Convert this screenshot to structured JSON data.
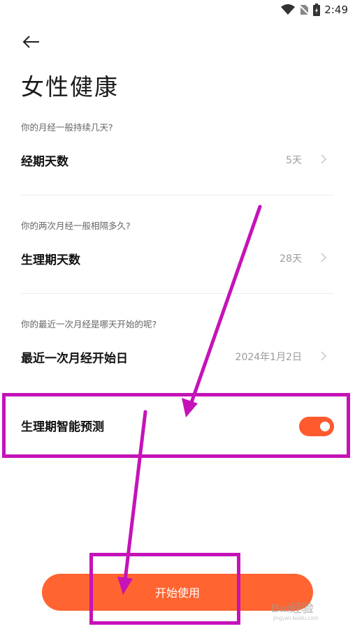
{
  "status_bar": {
    "time": "2:49"
  },
  "page": {
    "title": "女性健康"
  },
  "settings": [
    {
      "question": "你的月经一般持续几天?",
      "label": "经期天数",
      "value": "5天"
    },
    {
      "question": "你的两次月经一般相隔多久?",
      "label": "生理期天数",
      "value": "28天"
    },
    {
      "question": "你的最近一次月经是哪天开始的呢?",
      "label": "最近一次月经开始日",
      "value": "2024年1月2日"
    }
  ],
  "prediction": {
    "label": "生理期智能预测",
    "enabled": true
  },
  "start_button": {
    "label": "开始使用"
  },
  "watermark": {
    "text": "Bai经验",
    "sub": "jingyan.baidu.com"
  },
  "colors": {
    "accent": "#ff5a2e",
    "annotation": "#c513b8"
  }
}
